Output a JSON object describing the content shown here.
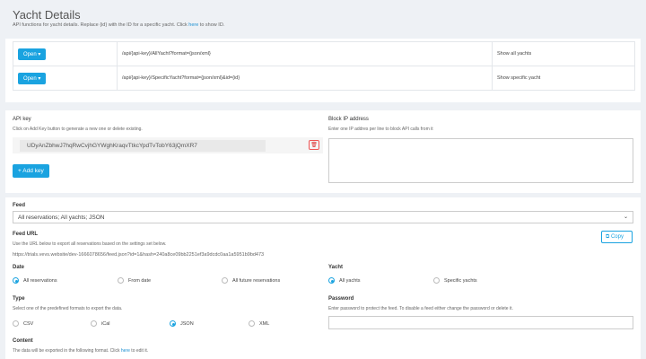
{
  "header": {
    "title": "Yacht Details",
    "subtitle_pre": "API functions for yacht details. Replace {id} with the ID for a specific yacht. Click ",
    "subtitle_link": "here",
    "subtitle_post": " to show ID."
  },
  "endpoints": [
    {
      "button": "Open ▾",
      "url": "/api/{api-key}/AllYacht?format={json/xml}",
      "desc": "Show all yachts"
    },
    {
      "button": "Open ▾",
      "url": "/api/{api-key}/SpecificYacht?format={json/xml}&id={id}",
      "desc": "Show specific yacht"
    }
  ],
  "apikey": {
    "label": "API key",
    "help": "Click on Add Key button to generate a new one or delete existing.",
    "key": "UDyAnZbhwJ7hqRwCvjhGYWghKraqvTtkcYpdTvTobY63jQmXR7",
    "add_label": "+ Add key"
  },
  "block": {
    "label": "Block IP address",
    "help": "Enter one IP addres per line to block API calls from it"
  },
  "feed": {
    "label": "Feed",
    "selected": "All reservations; All yachts; JSON",
    "url_label": "Feed URL",
    "url_help": "Use the URL below to export all reservations based on the settings set below.",
    "url": "https://trials.vevs.website/dev-1666078656/feed.json?id=1&hash=240a8ce09bb2251ef3a9dcdc0aa1a5951b9bd473",
    "copy_label": "Copy",
    "date_label": "Date",
    "date_options": [
      "All reservations",
      "From date",
      "All future reservations"
    ],
    "yacht_label": "Yacht",
    "yacht_options": [
      "All yachts",
      "Specific yachts"
    ],
    "type_label": "Type",
    "type_help": "Select one of the predefined formats to export the data.",
    "type_options": [
      "CSV",
      "iCal",
      "JSON",
      "XML"
    ],
    "password_label": "Password",
    "password_help": "Enter password to protect the feed. To disable a feed either change the password or delete it.",
    "content_label": "Content",
    "content_help_pre": "The data will be exported in the following format. Click ",
    "content_help_link": "here",
    "content_help_post": " to edit it."
  }
}
